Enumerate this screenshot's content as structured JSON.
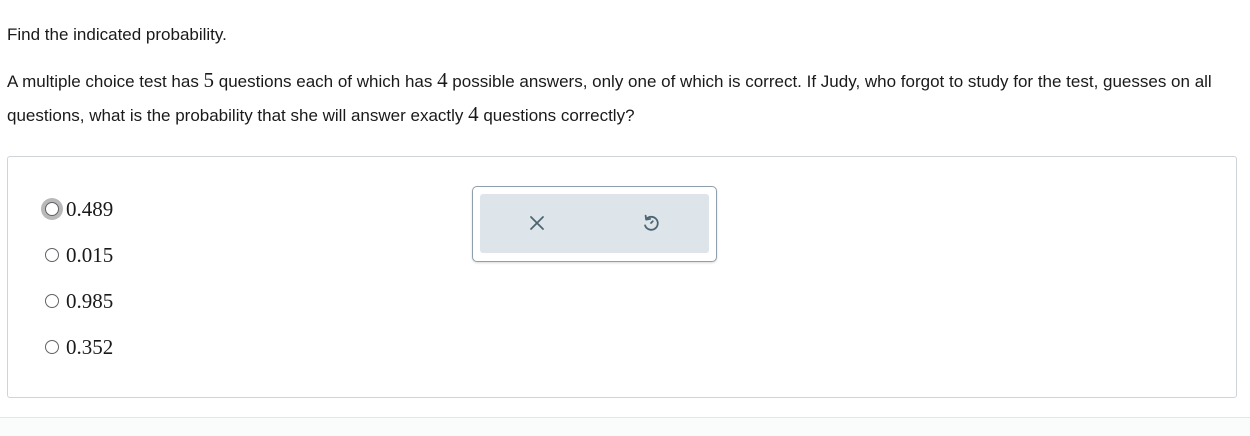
{
  "instruction": "Find the indicated probability.",
  "question": {
    "part1": "A multiple choice test has ",
    "num_questions": "5",
    "part2": " questions each of which has ",
    "num_answers": "4",
    "part3": " possible answers, only one of which is correct. If Judy, who forgot to study for the test, guesses on all questions, what is the probability that she will answer exactly ",
    "num_correct": "4",
    "part4": " questions correctly?"
  },
  "choices": [
    {
      "label": "0.489",
      "focused": true
    },
    {
      "label": "0.015",
      "focused": false
    },
    {
      "label": "0.985",
      "focused": false
    },
    {
      "label": "0.352",
      "focused": false
    }
  ],
  "toolbar": {
    "clear_icon": "close-icon",
    "reset_icon": "undo-icon"
  },
  "colors": {
    "toolbar_background": "#dde5ea",
    "toolbar_border": "#8fa0ac",
    "icon_color": "#4d6572",
    "radio_focus_ring": "#b9b9b9"
  }
}
